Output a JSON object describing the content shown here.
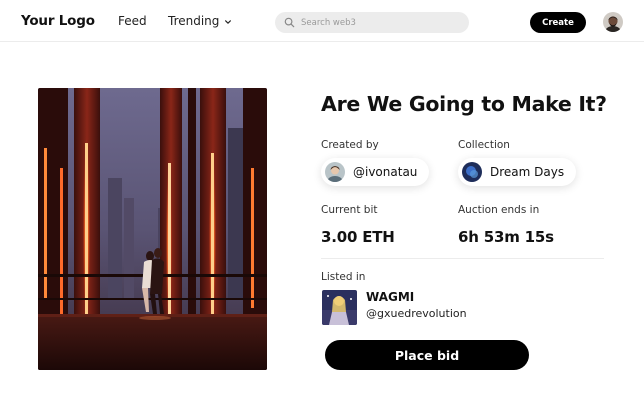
{
  "header": {
    "logo": "Your Logo",
    "nav": {
      "feed": "Feed",
      "trending": "Trending"
    },
    "search": {
      "placeholder": "Search web3",
      "value": ""
    },
    "create_label": "Create",
    "icons": {
      "search": "search-icon",
      "trending_caret": "chevron-down-icon",
      "profile": "user-avatar"
    }
  },
  "nft": {
    "title": "Are We Going to Make It?",
    "created_by": {
      "label": "Created by",
      "value": "@ivonatau"
    },
    "collection": {
      "label": "Collection",
      "value": "Dream Days"
    },
    "current_bid": {
      "label": "Current bit",
      "value": "3.00 ETH"
    },
    "auction": {
      "label": "Auction ends in",
      "value": "6h 53m 15s"
    },
    "listed_in": {
      "label": "Listed in",
      "name": "WAGMI",
      "handle": "@gxuedrevolution"
    },
    "bid_label": "Place bid"
  },
  "colors": {
    "accent": "#000000",
    "background": "#ffffff",
    "search_bg": "#ececec",
    "divider": "#ececec"
  }
}
